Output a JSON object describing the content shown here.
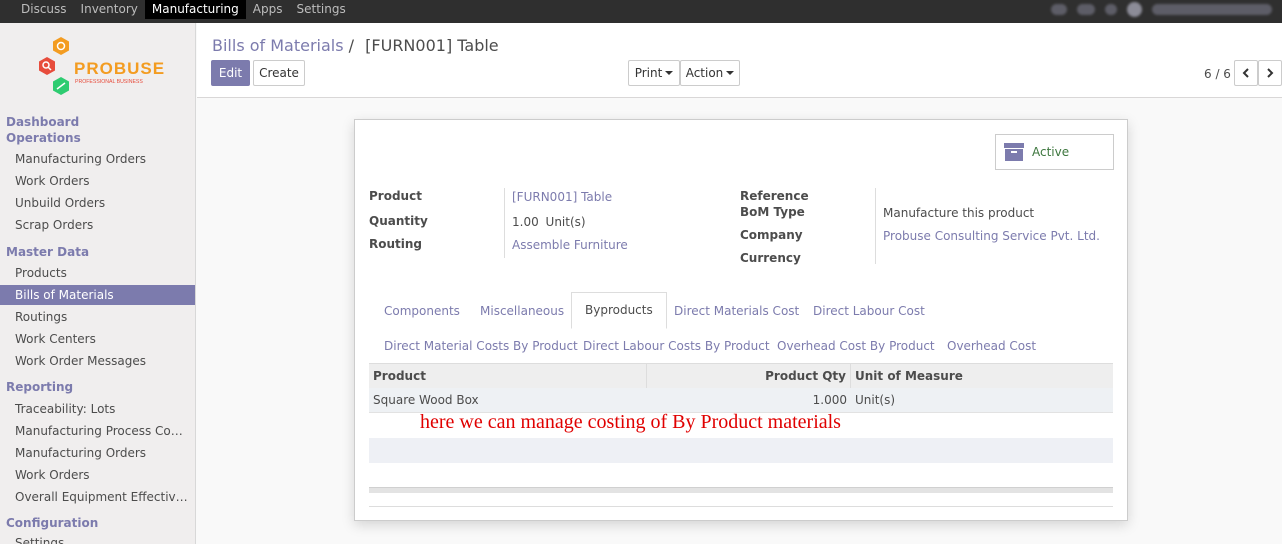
{
  "topbar": {
    "menu": [
      "Discuss",
      "Inventory",
      "Manufacturing",
      "Apps",
      "Settings"
    ],
    "active_index": 2
  },
  "sidebar": {
    "brand": "PROBUSE",
    "brand_tagline": "PROFESSIONAL BUSINESS",
    "sections": [
      {
        "title": "Dashboard",
        "items": []
      },
      {
        "title": "Operations",
        "items": [
          "Manufacturing Orders",
          "Work Orders",
          "Unbuild Orders",
          "Scrap Orders"
        ]
      },
      {
        "title": "Master Data",
        "items": [
          "Products",
          "Bills of Materials",
          "Routings",
          "Work Centers",
          "Work Order Messages"
        ]
      },
      {
        "title": "Reporting",
        "items": [
          "Traceability: Lots",
          "Manufacturing Process Co…",
          "Manufacturing Orders",
          "Work Orders",
          "Overall Equipment Effectiv…"
        ]
      },
      {
        "title": "Configuration",
        "items": [
          "Settings"
        ]
      }
    ],
    "active_item": "Bills of Materials"
  },
  "control_panel": {
    "breadcrumb_parent": "Bills of Materials",
    "breadcrumb_sep": "/",
    "breadcrumb_current": "[FURN001] Table",
    "edit_label": "Edit",
    "create_label": "Create",
    "print_label": "Print",
    "action_label": "Action",
    "pager": "6 / 6"
  },
  "form": {
    "archive_label": "Active",
    "left_fields": [
      {
        "label": "Product",
        "value": "[FURN001] Table",
        "link": true
      },
      {
        "label": "Quantity",
        "value": "1.00",
        "unit": "Unit(s)",
        "link": false
      },
      {
        "label": "Routing",
        "value": "Assemble Furniture",
        "link": true
      }
    ],
    "right_fields": [
      {
        "label": "Reference",
        "value": "",
        "link": false
      },
      {
        "label": "BoM Type",
        "value": "Manufacture this product",
        "link": false
      },
      {
        "label": "Company",
        "value": "Probuse Consulting Service Pvt. Ltd.",
        "link": true
      },
      {
        "label": "Currency",
        "value": "",
        "link": false
      }
    ],
    "tabs_row1": [
      "Components",
      "Miscellaneous",
      "Byproducts",
      "Direct Materials Cost",
      "Direct Labour Cost"
    ],
    "tabs_row2": [
      "Direct Material Costs By Product",
      "Direct Labour Costs By Product",
      "Overhead Cost By Product",
      "Overhead Cost"
    ],
    "active_tab": "Byproducts",
    "table": {
      "headers": [
        "Product",
        "Product Qty",
        "Unit of Measure"
      ],
      "rows": [
        {
          "product": "Square Wood Box",
          "qty": "1.000",
          "uom": "Unit(s)"
        }
      ]
    },
    "annotation": "here we can manage costing of By Product materials"
  },
  "colors": {
    "accent": "#7c7bad",
    "topbar": "#2f2f2f",
    "annotation": "#e00000",
    "active_status": "#3c763d"
  }
}
